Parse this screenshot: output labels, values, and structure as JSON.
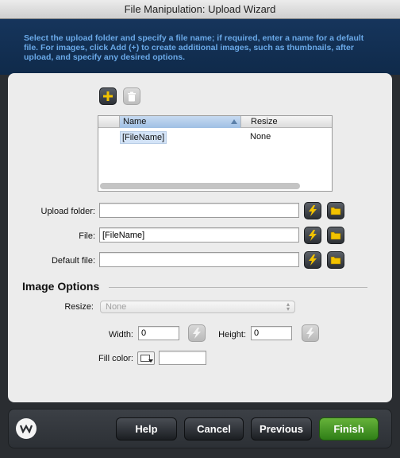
{
  "window": {
    "title": "File Manipulation: Upload Wizard"
  },
  "instructions": "Select the upload folder and specify a file name; if required, enter a name for a default file. For images, click Add (+) to create additional images, such as thumbnails, after upload, and specify any desired options.",
  "toolbar": {
    "add_icon": "plus-icon",
    "delete_icon": "trash-icon"
  },
  "table": {
    "columns": [
      "Name",
      "Resize"
    ],
    "rows": [
      {
        "name": "[FileName]",
        "resize": "None"
      }
    ]
  },
  "fields": {
    "upload_folder": {
      "label": "Upload folder:",
      "value": ""
    },
    "file": {
      "label": "File:",
      "value": "[FileName]"
    },
    "default_file": {
      "label": "Default file:",
      "value": ""
    }
  },
  "image_options": {
    "title": "Image Options",
    "resize_label": "Resize:",
    "resize_value": "None",
    "width_label": "Width:",
    "width_value": "0",
    "height_label": "Height:",
    "height_value": "0",
    "fill_color_label": "Fill color:",
    "fill_color_value": ""
  },
  "colors": {
    "header": "#16355c",
    "instructions": "#6aa9e8",
    "finish": "#3f9124",
    "lightning": "#f2c200"
  },
  "footer": {
    "help": "Help",
    "cancel": "Cancel",
    "previous": "Previous",
    "finish": "Finish"
  }
}
